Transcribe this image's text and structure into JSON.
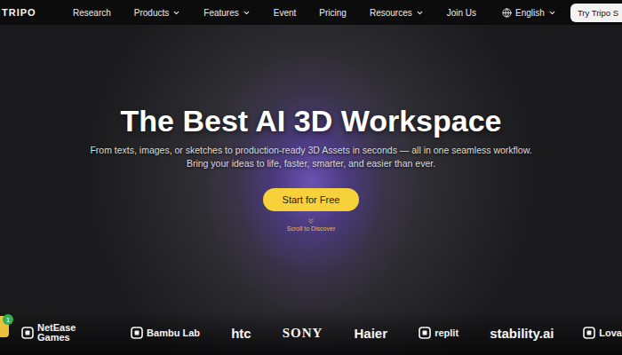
{
  "nav": {
    "logo": "TRIPO",
    "items": [
      {
        "label": "Research",
        "dropdown": false
      },
      {
        "label": "Products",
        "dropdown": true
      },
      {
        "label": "Features",
        "dropdown": true
      },
      {
        "label": "Event",
        "dropdown": false
      },
      {
        "label": "Pricing",
        "dropdown": false
      },
      {
        "label": "Resources",
        "dropdown": true
      },
      {
        "label": "Join Us",
        "dropdown": false
      }
    ],
    "language": "English",
    "cta": "Try Tripo S"
  },
  "hero": {
    "title": "The Best AI 3D Workspace",
    "subtitle": [
      "From texts, images, or sketches to production-ready 3D Assets in seconds — all in one seamless workflow.",
      "Bring your ideas to life, faster, smarter, and easier than ever."
    ],
    "button": "Start for Free",
    "scroll_hint": "Scroll to Discover"
  },
  "notification": {
    "count": "1"
  },
  "partners": [
    {
      "name": "NetEase Games",
      "kind": "mark"
    },
    {
      "name": "Bambu Lab",
      "kind": "mark"
    },
    {
      "name": "htc",
      "kind": "wordmark"
    },
    {
      "name": "SONY",
      "kind": "serif"
    },
    {
      "name": "Haier",
      "kind": "wordmark"
    },
    {
      "name": "replit",
      "kind": "mark"
    },
    {
      "name": "stability.ai",
      "kind": "wordmark"
    },
    {
      "name": "Lova",
      "kind": "mark"
    }
  ]
}
